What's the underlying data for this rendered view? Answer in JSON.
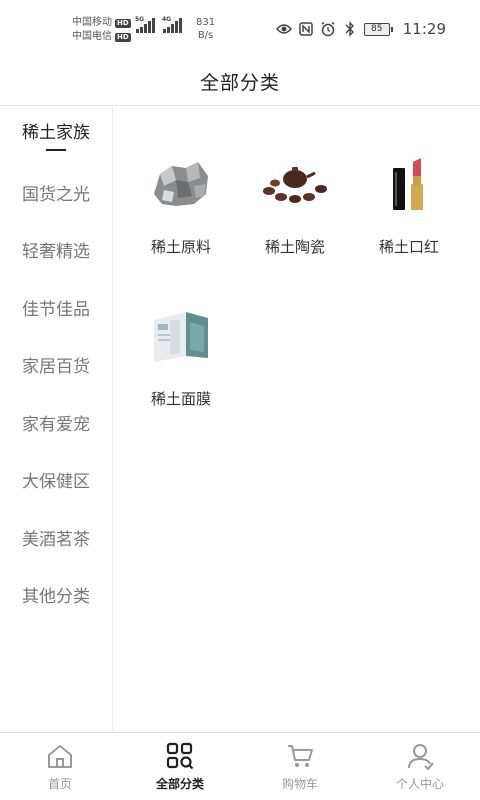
{
  "status_bar": {
    "carrier_1": "中国移动",
    "carrier_2": "中国电信",
    "hd_badge": "HD",
    "signal_1_tag": "5G",
    "signal_2_tag": "4G",
    "net_speed_value": "831",
    "net_speed_unit": "B/s",
    "battery_level": "85",
    "time": "11:29"
  },
  "header": {
    "title": "全部分类"
  },
  "sidebar": {
    "items": [
      {
        "label": "稀土家族",
        "active": true
      },
      {
        "label": "国货之光"
      },
      {
        "label": "轻奢精选"
      },
      {
        "label": "佳节佳品"
      },
      {
        "label": "家居百货"
      },
      {
        "label": "家有爱宠"
      },
      {
        "label": "大保健区"
      },
      {
        "label": "美酒茗茶"
      },
      {
        "label": "其他分类"
      }
    ]
  },
  "products": [
    {
      "name": "稀土原料",
      "icon": "mineral-ore-icon"
    },
    {
      "name": "稀土陶瓷",
      "icon": "tea-set-icon"
    },
    {
      "name": "稀土口红",
      "icon": "lipstick-icon"
    },
    {
      "name": "稀土面膜",
      "icon": "face-mask-box-icon"
    }
  ],
  "tabbar": {
    "items": [
      {
        "label": "首页",
        "icon": "home-icon"
      },
      {
        "label": "全部分类",
        "icon": "category-icon",
        "active": true
      },
      {
        "label": "购物车",
        "icon": "cart-icon"
      },
      {
        "label": "个人中心",
        "icon": "user-icon"
      }
    ]
  }
}
